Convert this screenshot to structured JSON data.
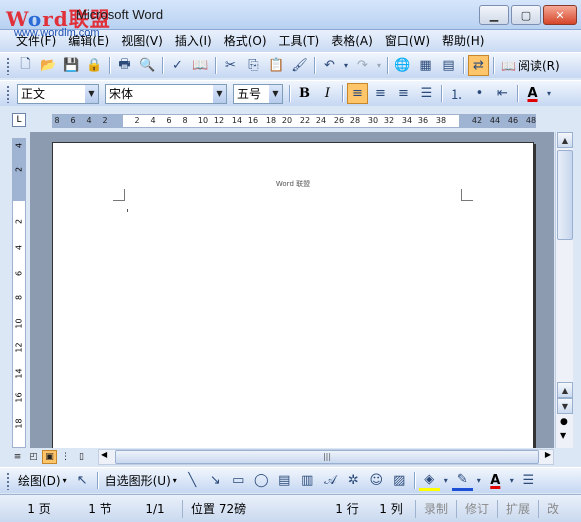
{
  "watermark": {
    "logo": "Word联盟",
    "url": "www.wordlm.com"
  },
  "title": {
    "app": "Microsoft Word"
  },
  "window_buttons": {
    "minimize": "▁",
    "maximize": "▢",
    "close": "✕"
  },
  "menu": [
    "文件(F)",
    "编辑(E)",
    "视图(V)",
    "插入(I)",
    "格式(O)",
    "工具(T)",
    "表格(A)",
    "窗口(W)",
    "帮助(H)"
  ],
  "standard_toolbar": {
    "icons": [
      "new-document-icon",
      "open-folder-icon",
      "save-icon",
      "permission-icon",
      "print-icon",
      "print-preview-icon",
      "spelling-icon",
      "research-icon",
      "cut-icon",
      "copy-icon",
      "paste-icon",
      "format-painter-icon",
      "undo-icon",
      "redo-icon",
      "hyperlink-icon",
      "tables-borders-icon",
      "insert-table-icon",
      "reading-layout-icon"
    ],
    "read_label": "阅读(R)"
  },
  "formatting_toolbar": {
    "style": "正文",
    "font": "宋体",
    "size": "五号",
    "bold": "B",
    "italic": "I",
    "font_color_label": "A"
  },
  "ruler": {
    "corner": "L",
    "hticks": [
      "8",
      "6",
      "4",
      "2",
      "2",
      "4",
      "6",
      "8",
      "10",
      "12",
      "14",
      "16",
      "18",
      "20",
      "22",
      "24",
      "26",
      "28",
      "30",
      "32",
      "34",
      "36",
      "38",
      "42",
      "44",
      "46",
      "48"
    ],
    "vticks": [
      "4",
      "2",
      "2",
      "4",
      "6",
      "8",
      "10",
      "12",
      "14",
      "16",
      "18"
    ]
  },
  "document": {
    "header_text": "Word 联盟"
  },
  "draw_toolbar": {
    "draw_label": "绘图(D)",
    "autoshapes_label": "自选图形(U)"
  },
  "status": {
    "page": "1 页",
    "section": "1 节",
    "page_of": "1/1",
    "position": "位置 72磅",
    "line": "1 行",
    "column": "1 列",
    "record": "录制",
    "revision": "修订",
    "extend": "扩展",
    "overtype": "改"
  },
  "colors": {
    "accent_active": "#ffc56a",
    "highlight_yellow": "#ffff00",
    "font_red": "#e00000"
  }
}
